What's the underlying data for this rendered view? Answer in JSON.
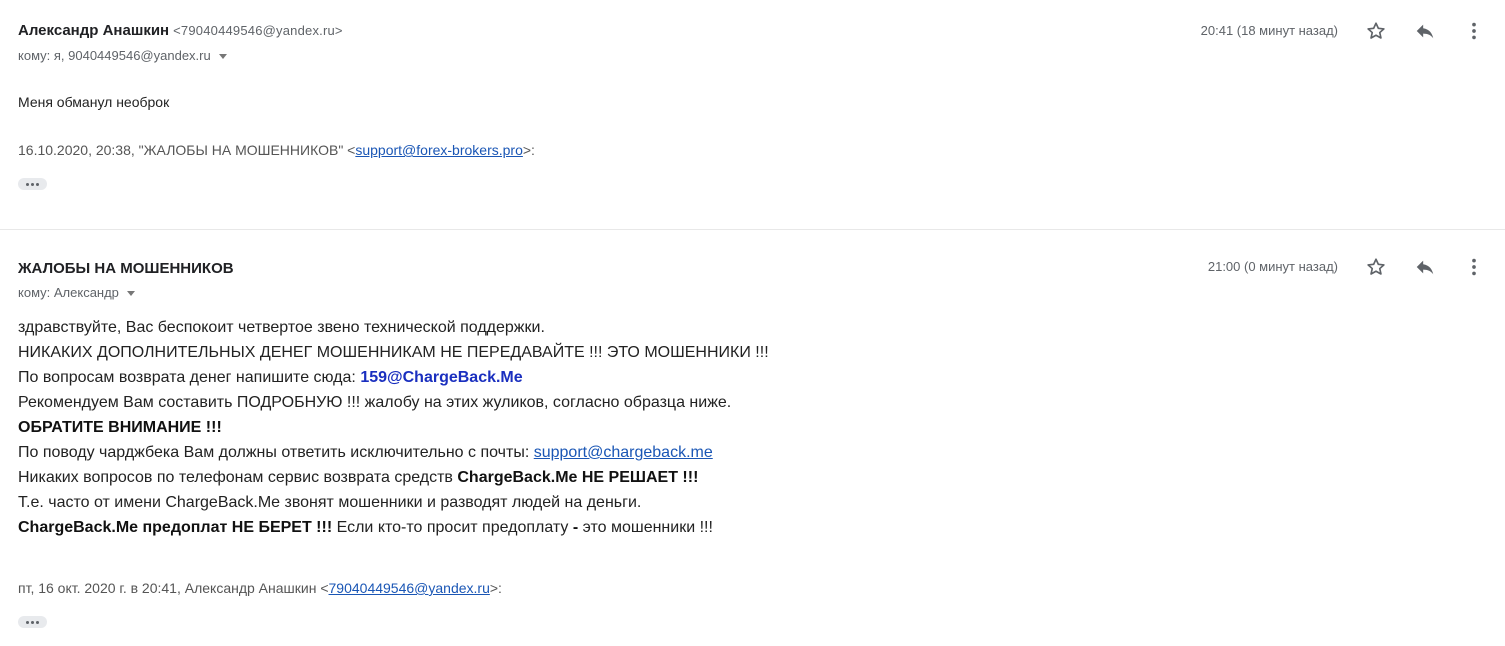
{
  "message1": {
    "sender_name": "Александр Анашкин",
    "sender_email": "<79040449546@yandex.ru>",
    "to_line": "кому: я, 9040449546@yandex.ru",
    "time": "20:41 (18 минут назад)",
    "body_line": "Меня обманул необрок",
    "quote_header_prefix": "16.10.2020, 20:38, \"ЖАЛОБЫ НА МОШЕННИКОВ\" <",
    "quote_header_link": "support@forex-brokers.pro",
    "quote_header_suffix": ">:"
  },
  "message2": {
    "sender_name": "ЖАЛОБЫ НА МОШЕННИКОВ",
    "to_line": "кому: Александр",
    "time": "21:00 (0 минут назад)",
    "lines": {
      "l1": "здравствуйте, Вас беспокоит четвертое звено технической поддержки.",
      "l2": "НИКАКИХ ДОПОЛНИТЕЛЬНЫХ ДЕНЕГ МОШЕННИКАМ НЕ ПЕРЕДАВАЙТЕ !!! ЭТО МОШЕННИКИ !!!",
      "l3_prefix": "По вопросам возврата денег напишите сюда: ",
      "l3_email": "159@ChargeBack.Me",
      "l4": "Рекомендуем Вам составить ПОДРОБНУЮ !!! жалобу на этих жуликов, согласно образца ниже.",
      "l5": "ОБРАТИТЕ ВНИМАНИЕ !!!",
      "l6_prefix": "По поводу чарджбека Вам должны ответить исключительно с почты: ",
      "l6_link": "support@chargeback.me",
      "l7_prefix": "Никаких вопросов по телефонам сервис возврата средств ",
      "l7_bold": "ChargeBack.Me НЕ РЕШАЕТ !!!",
      "l8": "Т.е. часто от имени ChargeBack.Me звонят мошенники и разводят людей на деньги.",
      "l9_bold": "ChargeBack.Me предоплат НЕ БЕРЕТ !!!",
      "l9_mid": " Если кто-то просит предоплату ",
      "l9_dash": "-",
      "l9_suffix": " это мошенники !!!"
    },
    "quote_header_prefix": "пт, 16 окт. 2020 г. в 20:41, Александр Анашкин <",
    "quote_header_link": "79040449546@yandex.ru",
    "quote_header_suffix": ">:"
  },
  "icons": {
    "star": "star-icon",
    "reply": "reply-icon",
    "more": "more-vert-icon"
  },
  "colors": {
    "link": "#1a56b5",
    "highlight_email": "#1a2fbf",
    "icon": "#5f6368"
  }
}
